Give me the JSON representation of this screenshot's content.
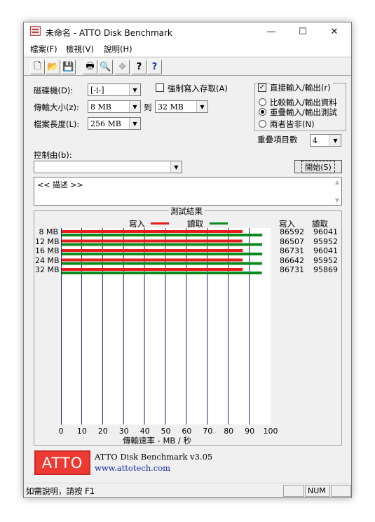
{
  "window": {
    "title": "未命名 - ATTO Disk Benchmark",
    "controls": {
      "minimize": "—",
      "maximize": "☐",
      "close": "✕"
    }
  },
  "menu": {
    "items": [
      "檔案(F)",
      "檢視(V)",
      "說明(H)"
    ]
  },
  "toolbar": {
    "icons": [
      "new-document-icon",
      "open-folder-icon",
      "save-icon",
      "print-icon",
      "print-preview-icon",
      "move-icon",
      "help-icon",
      "context-help-icon"
    ],
    "glyphs": [
      "🗋",
      "📂",
      "💾",
      "🖶",
      "🔍",
      "✥",
      "?",
      "?"
    ]
  },
  "settings": {
    "drive_label": "磁碟機(D):",
    "drive_value": "[-i-]",
    "transfer_label": "傳輸大小(z):",
    "transfer_from": "8 MB",
    "transfer_to_label": "到",
    "transfer_to": "32 MB",
    "file_length_label": "檔案長度(L):",
    "file_length": "256 MB",
    "force_write_label": "強制寫入存取(A)",
    "force_write_checked": false,
    "direct_io_label": "直接輸入/輸出(r)",
    "direct_io_checked": true,
    "io_modes": [
      {
        "label": "比較輸入/輸出資料",
        "selected": false
      },
      {
        "label": "重疊輸入/輸出測試",
        "selected": true
      },
      {
        "label": "兩者皆非(N)",
        "selected": false
      }
    ],
    "queue_depth_label": "重疊項目數",
    "queue_depth": "4",
    "controlled_by_label": "控制由(b):",
    "controlled_by_value": "",
    "start_button": "開始(S)",
    "description": "<< 描述 >>"
  },
  "results": {
    "title": "測試結果",
    "legend_write": "寫入",
    "legend_read": "讀取",
    "col_write": "寫入",
    "col_read": "讀取",
    "write_color": "#e81c1c",
    "read_color": "#0b8a1d",
    "axis_label": "傳輸速率 - MB / 秒"
  },
  "chart_data": {
    "type": "bar",
    "categories": [
      "8 MB",
      "12 MB",
      "16 MB",
      "24 MB",
      "32 MB"
    ],
    "series": [
      {
        "name": "寫入",
        "values": [
          86592,
          86507,
          86731,
          86642,
          86731
        ]
      },
      {
        "name": "讀取",
        "values": [
          96041,
          95952,
          96041,
          95952,
          95869
        ]
      }
    ],
    "x_ticks": [
      "0",
      "10",
      "20",
      "30",
      "40",
      "50",
      "60",
      "70",
      "80",
      "90",
      "100"
    ],
    "xlim": [
      0,
      100
    ],
    "xlabel": "傳輸速率 - MB / 秒",
    "grid": true,
    "legend": "top"
  },
  "footer": {
    "logo": "ATTO",
    "product": "ATTO Disk Benchmark v3.05",
    "url": "www.attotech.com"
  },
  "status": {
    "text": "如需說明，請按 F1",
    "indicator": "NUM"
  }
}
